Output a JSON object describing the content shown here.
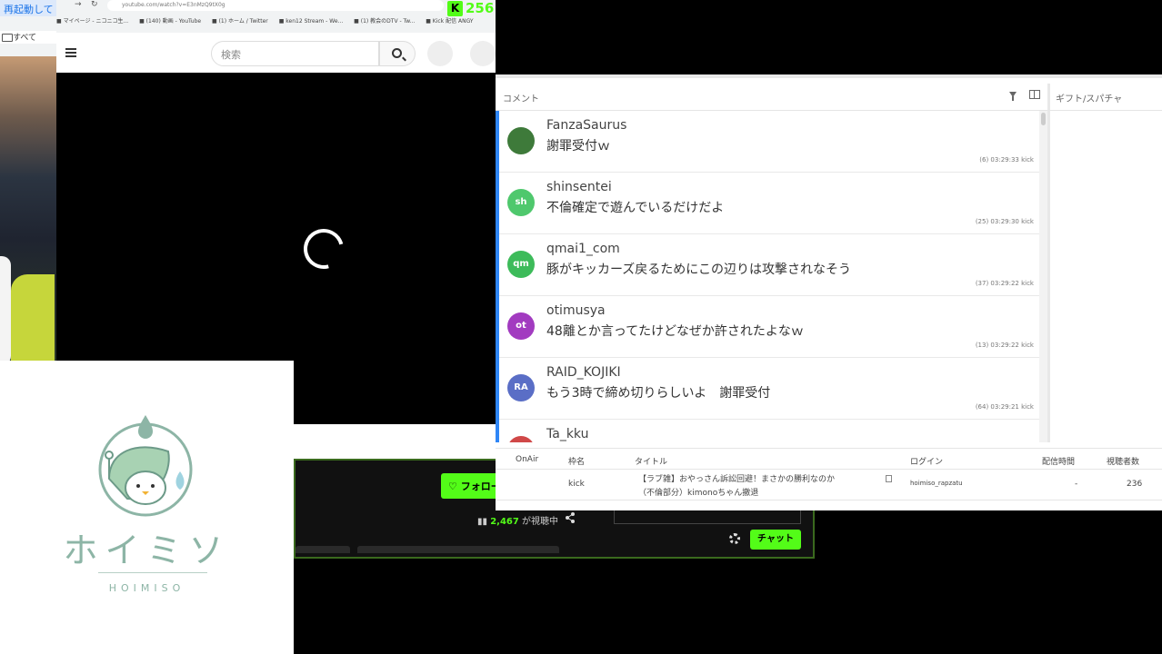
{
  "browser": {
    "tab_label": "再起動して",
    "url": "youtube.com/watch?v=E3nMzQ9tX0g",
    "bookmarks": [
      "マイページ - ニコニコ生...",
      "(140) 動画 - YouTube",
      "(1) ホーム / Twitter",
      "ken12 Stream - We...",
      "(1) 教会のDTV - Tw...",
      "Kick 配信 ANGY"
    ],
    "folder_label": "すべて",
    "kick_count": "256"
  },
  "youtube": {
    "search_placeholder": "検索"
  },
  "kick_panel": {
    "follow_label": "♡ フォロー",
    "viewers_count": "2,467",
    "viewers_suffix": "が視聴中",
    "chat_button": "チャット"
  },
  "logo": {
    "name_jp": "ホイミソ",
    "name_en": "HOIMISO"
  },
  "comment_viewer": {
    "title": "コメント",
    "gift_title": "ギフト/スパチャ",
    "comments": [
      {
        "avatar": "",
        "avatar_color": "#3e7a3a",
        "user": "FanzaSaurus",
        "text": "謝罪受付ｗ",
        "meta": "(6)   03:29:33   kick"
      },
      {
        "avatar": "sh",
        "avatar_color": "#4fc86d",
        "user": "shinsentei",
        "text": "不倫確定で遊んでいるだけだよ",
        "meta": "(25)   03:29:30   kick"
      },
      {
        "avatar": "qm",
        "avatar_color": "#3dbb5a",
        "user": "qmai1_com",
        "text": "豚がキッカーズ戻るためにこの辺りは攻撃されなそう",
        "meta": "(37)   03:29:22   kick"
      },
      {
        "avatar": "ot",
        "avatar_color": "#a23bc0",
        "user": "otimusya",
        "text": "48離とか言ってたけどなぜか許されたよなｗ",
        "meta": "(13)   03:29:22   kick"
      },
      {
        "avatar": "RA",
        "avatar_color": "#5a6ec6",
        "user": "RAID_KOJIKI",
        "text": "もう3時で締め切りらしいよ　謝罪受付",
        "meta": "(64)   03:29:21   kick"
      },
      {
        "avatar": "",
        "avatar_color": "#d04848",
        "user": "Ta_kku",
        "text": "",
        "meta": ""
      }
    ],
    "table": {
      "headers": [
        "OnAir",
        "枠名",
        "タイトル",
        "ログイン",
        "配信時間",
        "視聴者数"
      ],
      "row": {
        "onair": "",
        "frame": "kick",
        "title_line1": "【ラブ雑】おやっさん訴訟回避！まさかの勝利なのか",
        "title_line2": "（不倫部分）kimonoちゃん撤退",
        "login": "hoimiso_rapzatu",
        "duration": "-",
        "viewers": "236"
      }
    }
  }
}
